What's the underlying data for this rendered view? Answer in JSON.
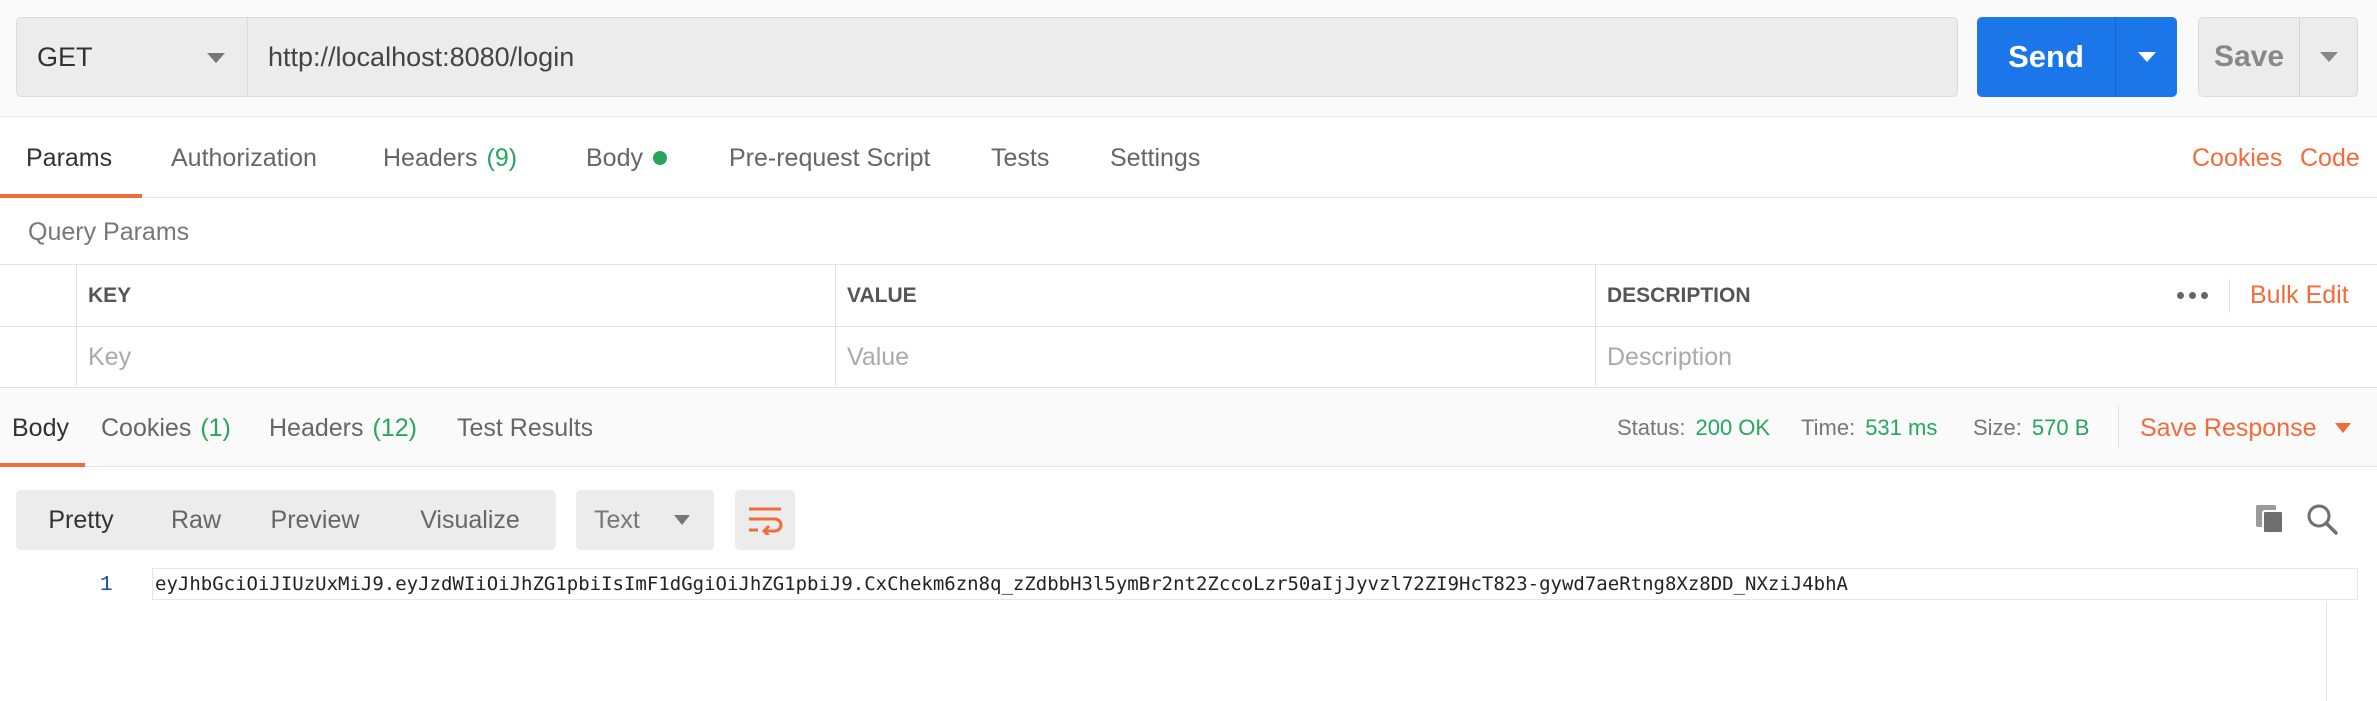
{
  "request": {
    "method": "GET",
    "url": "http://localhost:8080/login",
    "send_label": "Send",
    "save_label": "Save"
  },
  "request_tabs": [
    {
      "label": "Params",
      "active": true
    },
    {
      "label": "Authorization"
    },
    {
      "label": "Headers",
      "count": "(9)"
    },
    {
      "label": "Body",
      "indicator": "green-dot"
    },
    {
      "label": "Pre-request Script"
    },
    {
      "label": "Tests"
    },
    {
      "label": "Settings"
    }
  ],
  "request_links": {
    "cookies": "Cookies",
    "code": "Code"
  },
  "query_params": {
    "title": "Query Params",
    "columns": [
      "KEY",
      "VALUE",
      "DESCRIPTION"
    ],
    "placeholders": {
      "key": "Key",
      "value": "Value",
      "description": "Description"
    },
    "bulk_edit": "Bulk Edit"
  },
  "response_tabs": [
    {
      "label": "Body",
      "active": true
    },
    {
      "label": "Cookies",
      "count": "(1)"
    },
    {
      "label": "Headers",
      "count": "(12)"
    },
    {
      "label": "Test Results"
    }
  ],
  "response_status": {
    "status_label": "Status:",
    "status_value": "200 OK",
    "time_label": "Time:",
    "time_value": "531 ms",
    "size_label": "Size:",
    "size_value": "570 B",
    "save_response": "Save Response"
  },
  "response_view": {
    "modes": [
      "Pretty",
      "Raw",
      "Preview",
      "Visualize"
    ],
    "active_mode": "Pretty",
    "format": "Text"
  },
  "response_body": {
    "line_numbers": [
      "1"
    ],
    "lines": [
      "eyJhbGciOiJIUzUxMiJ9.eyJzdWIiOiJhZG1pbiIsImF1dGgiOiJhZG1pbiJ9.CxChekm6zn8q_zZdbbH3l5ymBr2nt2ZccoLzr50aIjJyvzl72ZI9HcT823-gywd7aeRtng8Xz8DD_NXziJ4bhA"
    ]
  },
  "colors": {
    "accent_orange": "#f26b3a",
    "send_blue": "#1b76ea",
    "success_green": "#26a65b"
  }
}
